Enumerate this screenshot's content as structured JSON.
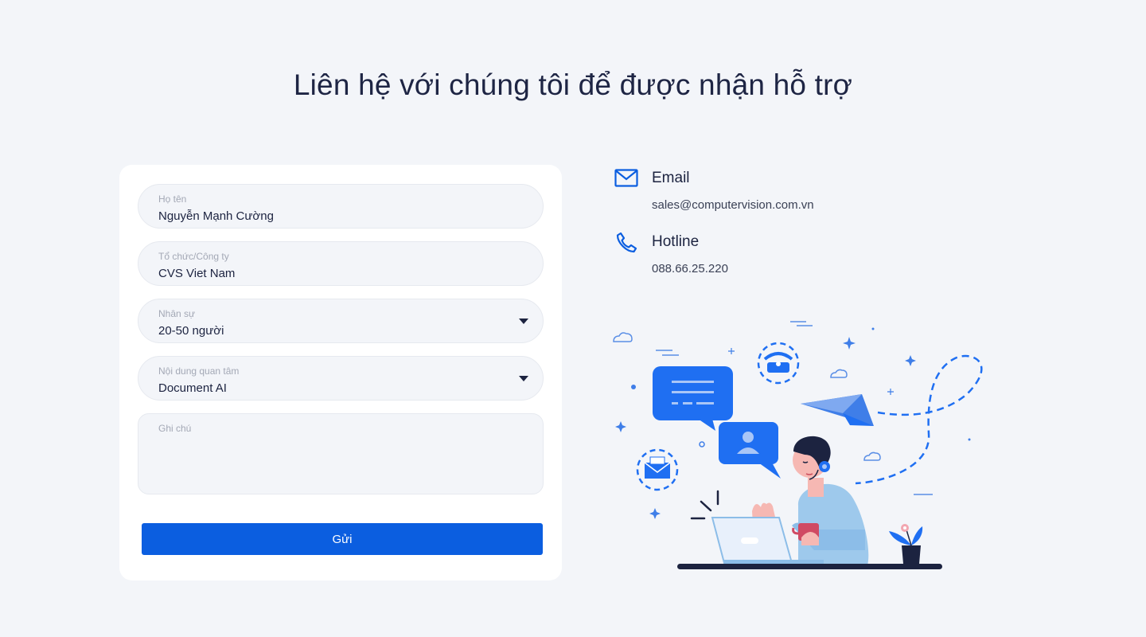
{
  "page": {
    "title": "Liên hệ với chúng tôi để được nhận hỗ trợ"
  },
  "form": {
    "fields": [
      {
        "label": "Họ tên",
        "value": "Nguyễn Mạnh Cường"
      },
      {
        "label": "Tổ chức/Công ty",
        "value": "CVS Viet Nam"
      },
      {
        "label": "Nhân sự",
        "value": "20-50 người"
      },
      {
        "label": "Nội dung quan tâm",
        "value": "Document AI"
      },
      {
        "label": "Ghi chú",
        "value": ""
      }
    ],
    "submit_label": "Gửi"
  },
  "contact": {
    "email": {
      "title": "Email",
      "value": "sales@computervision.com.vn",
      "icon": "mail-icon"
    },
    "hotline": {
      "title": "Hotline",
      "value": "088.66.25.220",
      "icon": "phone-icon"
    }
  },
  "colors": {
    "accent": "#0b5ee0",
    "bubble": "#1f6ff2",
    "text": "#1c2340",
    "background": "#f3f5f9"
  }
}
